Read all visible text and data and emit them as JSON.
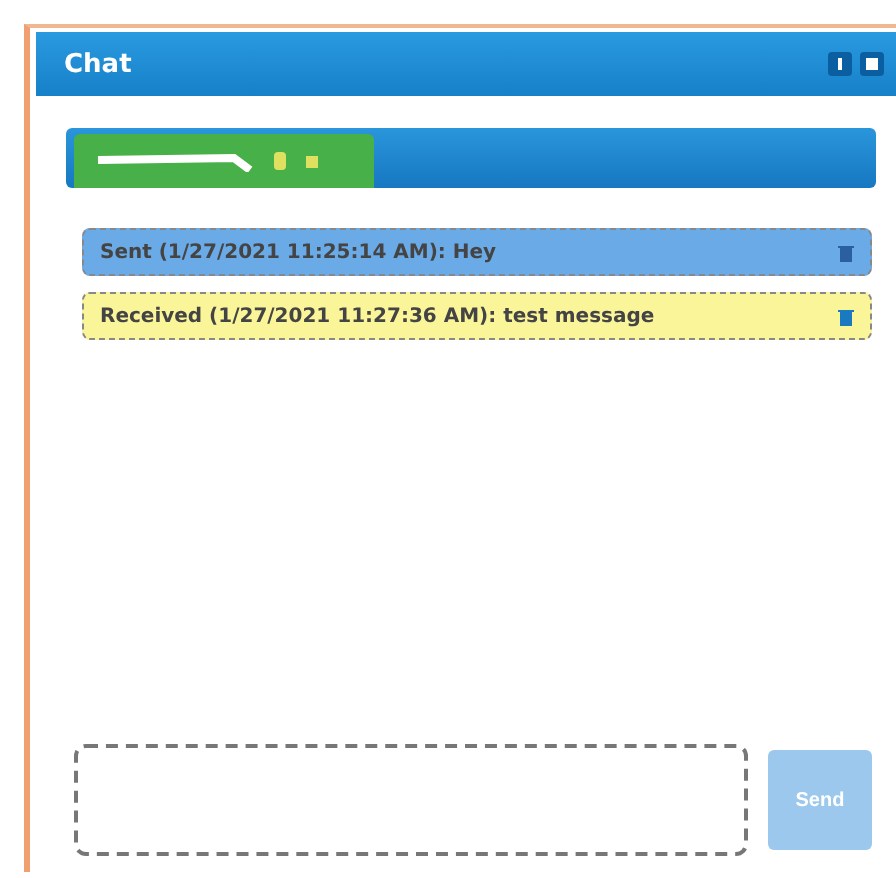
{
  "window": {
    "title": "Chat"
  },
  "tabs": [
    {
      "selected": true
    }
  ],
  "messages": [
    {
      "kind": "sent",
      "text": "Sent (1/27/2021 11:25:14 AM):  Hey"
    },
    {
      "kind": "received",
      "text": "Received (1/27/2021 11:27:36 AM):  test message"
    }
  ],
  "send_button": {
    "label": "Send",
    "disabled": true
  }
}
